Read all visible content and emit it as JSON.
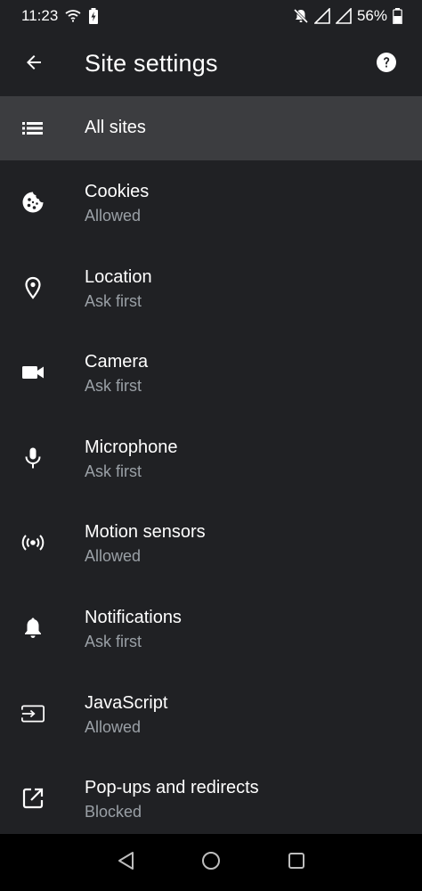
{
  "status_bar": {
    "time": "11:23",
    "battery_percent": "56%"
  },
  "app_bar": {
    "title": "Site settings"
  },
  "all_sites": {
    "label": "All sites"
  },
  "settings": [
    {
      "title": "Cookies",
      "subtitle": "Allowed",
      "icon": "cookie-icon"
    },
    {
      "title": "Location",
      "subtitle": "Ask first",
      "icon": "location-pin-icon"
    },
    {
      "title": "Camera",
      "subtitle": "Ask first",
      "icon": "camera-icon"
    },
    {
      "title": "Microphone",
      "subtitle": "Ask first",
      "icon": "microphone-icon"
    },
    {
      "title": "Motion sensors",
      "subtitle": "Allowed",
      "icon": "sensors-icon"
    },
    {
      "title": "Notifications",
      "subtitle": "Ask first",
      "icon": "bell-icon"
    },
    {
      "title": "JavaScript",
      "subtitle": "Allowed",
      "icon": "javascript-icon"
    },
    {
      "title": "Pop-ups and redirects",
      "subtitle": "Blocked",
      "icon": "open-in-new-icon"
    }
  ],
  "colors": {
    "background": "#202124",
    "selected_row": "#3c3d40",
    "primary_text": "#ffffff",
    "secondary_text": "#9aa0a6",
    "nav_bar": "#000000"
  }
}
